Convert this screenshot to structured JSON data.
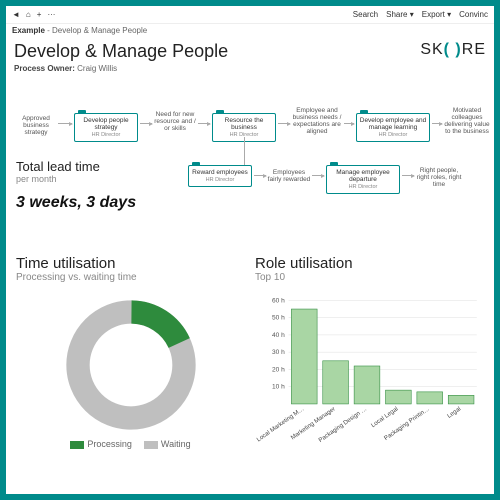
{
  "toolbar": {
    "back": "◄",
    "home": "⌂",
    "add": "+",
    "more": "···",
    "search": "Search",
    "share": "Share ▾",
    "export": "Export ▾",
    "convince": "Convinc"
  },
  "breadcrumb": {
    "root": "Example",
    "sep": " - ",
    "page": "Develop & Manage People"
  },
  "title": "Develop & Manage People",
  "owner_label": "Process Owner:",
  "owner_name": "Craig Willis",
  "logo": {
    "pre": "SK",
    "paren": "( )",
    "post": "RE"
  },
  "flow": {
    "n1": "Approved business strategy",
    "b1": {
      "title": "Develop people strategy",
      "role": "HR Director"
    },
    "n2": "Need for new resource and / or skills",
    "b2": {
      "title": "Resource the business",
      "role": "HR Director"
    },
    "n3": "Employee and business needs / expectations are aligned",
    "b3": {
      "title": "Develop employee and manage learning",
      "role": "HR Director"
    },
    "n4": "Motivated colleagues delivering value to the business",
    "b4": {
      "title": "Reward employees",
      "role": "HR Director"
    },
    "n5": "Employees fairly rewarded",
    "b5": {
      "title": "Manage employee departure",
      "role": "HR Director"
    },
    "n6": "Right people, right roles, right time"
  },
  "leadtime": {
    "title": "Total lead time",
    "sub": "per month",
    "value": "3 weeks, 3 days"
  },
  "time_util": {
    "title": "Time utilisation",
    "sub": "Processing vs. waiting time",
    "legend_processing": "Processing",
    "legend_waiting": "Waiting"
  },
  "role_util": {
    "title": "Role utilisation",
    "sub": "Top 10",
    "ticks": [
      "60 h",
      "50 h",
      "40 h",
      "30 h",
      "20 h",
      "10 h"
    ]
  },
  "chart_data": [
    {
      "type": "pie",
      "title": "Time utilisation",
      "series": [
        {
          "name": "Processing",
          "value": 18,
          "color": "#2e8b3d"
        },
        {
          "name": "Waiting",
          "value": 82,
          "color": "#bfbfbf"
        }
      ]
    },
    {
      "type": "bar",
      "title": "Role utilisation",
      "ylabel": "hours",
      "ylim": [
        0,
        60
      ],
      "categories": [
        "Local Marketing M…",
        "Marketing Manager",
        "Packaging Design …",
        "Local Legal",
        "Packaging Printin…",
        "Legal"
      ],
      "values": [
        55,
        25,
        22,
        8,
        7,
        5
      ],
      "color": "#a9d6a4",
      "border": "#2e8b3d"
    }
  ]
}
